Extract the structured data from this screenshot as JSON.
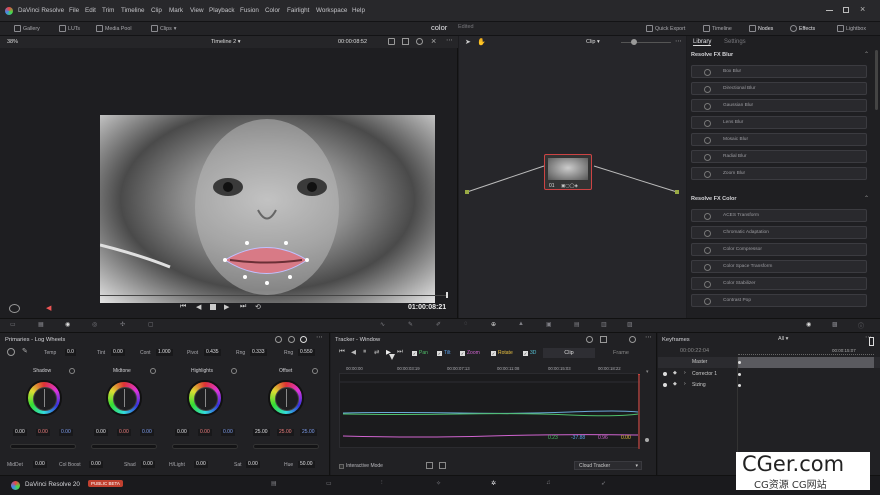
{
  "app": {
    "title": "DaVinci Resolve",
    "menu": [
      "File",
      "Edit",
      "Trim",
      "Timeline",
      "Clip",
      "Mark",
      "View",
      "Playback",
      "Fusion",
      "Color",
      "Fairlight",
      "Workspace",
      "Help"
    ],
    "page_name": "color",
    "status": "Edited"
  },
  "toolbar": {
    "gallery": "Gallery",
    "luts": "LUTs",
    "media_pool": "Media Pool",
    "clips": "Clips",
    "quick_export": "Quick Export",
    "timeline": "Timeline",
    "nodes": "Nodes",
    "effects": "Effects",
    "lightbox": "Lightbox"
  },
  "viewer": {
    "zoom": "38%",
    "timeline_name": "Timeline 2",
    "timecode_top": "00:00:08:52",
    "timecode": "01:00:08:21"
  },
  "nodes": {
    "mode": "Clip",
    "node_label": "01"
  },
  "library": {
    "tabs": [
      "Library",
      "Settings"
    ],
    "section_blur": "Resolve FX Blur",
    "blur_items": [
      "Box Blur",
      "Directional Blur",
      "Gaussian Blur",
      "Lens Blur",
      "Mosaic Blur",
      "Radial Blur",
      "Zoom Blur"
    ],
    "section_color": "Resolve FX Color",
    "color_items": [
      "ACES Transform",
      "Chromatic Adaptation",
      "Color Compressor",
      "Color Space Transform",
      "Color Stabilizer",
      "Contrast Pop"
    ]
  },
  "primaries": {
    "title": "Primaries - Log Wheels",
    "params_top": [
      {
        "label": "Temp",
        "value": "0.0"
      },
      {
        "label": "Tint",
        "value": "0.00"
      },
      {
        "label": "Cont",
        "value": "1.000"
      },
      {
        "label": "Pivot",
        "value": "0.435"
      },
      {
        "label": "Rng",
        "value": "0.333"
      },
      {
        "label": "Rng",
        "value": "0.550"
      }
    ],
    "wheels": [
      {
        "name": "Shadow",
        "values": [
          "0.00",
          "0.00",
          "0.00"
        ]
      },
      {
        "name": "Midtone",
        "values": [
          "0.00",
          "0.00",
          "0.00"
        ]
      },
      {
        "name": "Highlights",
        "values": [
          "0.00",
          "0.00",
          "0.00"
        ]
      },
      {
        "name": "Offset",
        "values": [
          "25.00",
          "25.00",
          "25.00"
        ]
      }
    ],
    "params_bottom": [
      {
        "label": "MidDet",
        "value": "0.00"
      },
      {
        "label": "Col Boost",
        "value": "0.00"
      },
      {
        "label": "Shad",
        "value": "0.00"
      },
      {
        "label": "H/Light",
        "value": "0.00"
      },
      {
        "label": "Sat",
        "value": "0.00"
      },
      {
        "label": "Hue",
        "value": "50.00"
      }
    ]
  },
  "tracker": {
    "title": "Tracker - Window",
    "checks": [
      "Pan",
      "Tilt",
      "Zoom",
      "Rotate",
      "3D"
    ],
    "check_colors": [
      "#4fc06a",
      "#5aa0e8",
      "#d064d0",
      "#e8c040",
      "#56c4d8"
    ],
    "clip_tab": "Clip",
    "frame_tab": "Frame",
    "times": [
      "00:00:00",
      "00:00:03:19",
      "00:00:07:13",
      "00:00:11:08",
      "00:00:15:03",
      "00:00:18:22"
    ],
    "readouts": [
      "0.23",
      "-37.88",
      "0.96",
      "0.00"
    ],
    "interactive_mode": "Interactive Mode",
    "cloud_tracker": "Cloud Tracker"
  },
  "keyframes": {
    "title": "Keyframes",
    "filter": "All",
    "timecode": "00:00:22:04",
    "end_time": "00:00:15:07",
    "tracks": [
      "Master",
      "Corrector 1",
      "Sizing"
    ]
  },
  "bottom": {
    "version": "DaVinci Resolve 20",
    "badge": "PUBLIC BETA"
  },
  "watermark": {
    "top": "CGer.com",
    "bottom": "CG资源 CG网站"
  }
}
